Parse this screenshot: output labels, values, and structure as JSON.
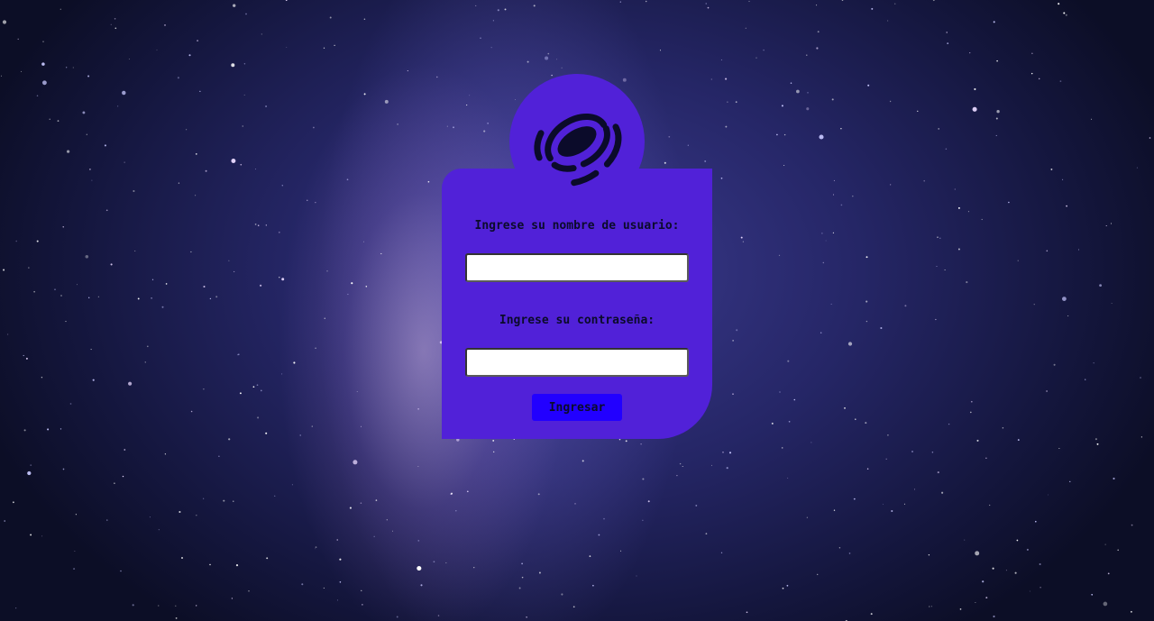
{
  "login": {
    "username_label": "Ingrese su nombre de usuario:",
    "username_value": "",
    "password_label": "Ingrese su contraseña:",
    "password_value": "",
    "submit_label": "Ingresar"
  },
  "icons": {
    "logo": "galaxy-icon"
  },
  "colors": {
    "card": "#5121d8",
    "button": "#2200ff",
    "text": "#0b0b2a",
    "background": "#14183a"
  }
}
